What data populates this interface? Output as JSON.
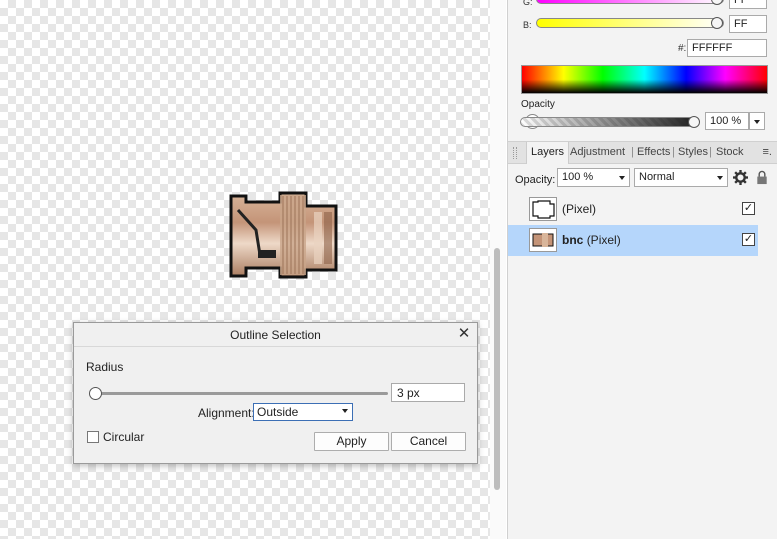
{
  "dialog": {
    "title": "Outline Selection",
    "close_glyph": "✕",
    "radius_label": "Radius",
    "radius_value": "3 px",
    "radius_slider_fraction": 0.0,
    "alignment_label": "Alignment:",
    "alignment_value": "Outside",
    "circular_label": "Circular",
    "circular_checked": false,
    "apply_label": "Apply",
    "cancel_label": "Cancel"
  },
  "color_panel": {
    "g_label": "G:",
    "g_value": "FF",
    "b_label": "B:",
    "b_value": "FF",
    "hex_label": "#:",
    "hex_value": "FFFFFF",
    "opacity_label": "Opacity",
    "opacity_value": "100 %"
  },
  "layers_panel": {
    "tabs": [
      "Layers",
      "Adjustment",
      "Effects",
      "Styles",
      "Stock"
    ],
    "active_tab": "Layers",
    "tab_separator": "|",
    "menu_glyph": "≡.",
    "opacity_label": "Opacity:",
    "opacity_value": "100 %",
    "blend_mode": "Normal",
    "settings_icon": "gear-icon",
    "lock_icon": "lock-icon",
    "layers": [
      {
        "name_bold": "",
        "name": "(Pixel)",
        "visible": true,
        "selected": false,
        "check_glyph": "✓"
      },
      {
        "name_bold": "bnc",
        "name": "(Pixel)",
        "visible": true,
        "selected": true,
        "check_glyph": "✓"
      }
    ]
  },
  "colors": {
    "selection_bg": "#b5d6fb",
    "accent": "#3c6fb5"
  }
}
